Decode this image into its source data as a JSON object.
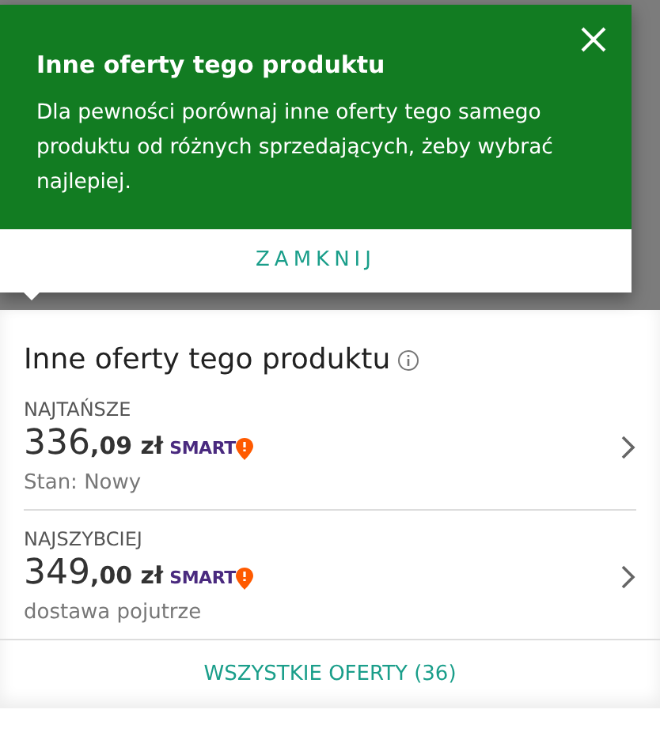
{
  "popup": {
    "title": "Inne oferty tego produktu",
    "body": "Dla pewności porównaj inne oferty tego samego produktu od różnych sprzedających, żeby wybrać najlepiej.",
    "action": "ZAMKNIJ"
  },
  "section": {
    "title": "Inne oferty tego produktu",
    "offers": [
      {
        "label": "NAJTAŃSZE",
        "price_whole": "336",
        "price_rest": ",09 zł",
        "badge": "SMART",
        "note": "Stan: Nowy"
      },
      {
        "label": "NAJSZYBCIEJ",
        "price_whole": "349",
        "price_rest": ",00 zł",
        "badge": "SMART",
        "note": "dostawa pojutrze"
      }
    ],
    "all_offers": "WSZYSTKIE OFERTY (36)"
  }
}
